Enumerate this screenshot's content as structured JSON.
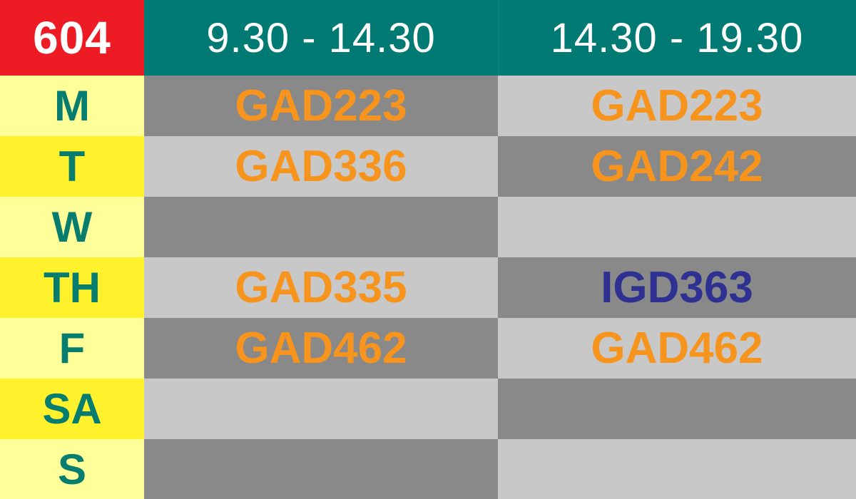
{
  "header": {
    "room": "604",
    "times": [
      "9.30  -  14.30",
      "14.30  -  19.30"
    ]
  },
  "rows": [
    {
      "day": "M",
      "slots": [
        "GAD223",
        "GAD223"
      ]
    },
    {
      "day": "T",
      "slots": [
        "GAD336",
        "GAD242"
      ]
    },
    {
      "day": "W",
      "slots": [
        "",
        ""
      ]
    },
    {
      "day": "TH",
      "slots": [
        "GAD335",
        "IGD363"
      ]
    },
    {
      "day": "F",
      "slots": [
        "GAD462",
        "GAD462"
      ]
    },
    {
      "day": "SA",
      "slots": [
        "",
        ""
      ]
    },
    {
      "day": "S",
      "slots": [
        "",
        ""
      ]
    }
  ],
  "colors": {
    "room_bg": "#ed1c24",
    "header_bg": "#007a73",
    "day_text": "#077d6f",
    "day_bg_light": "#ffff99",
    "day_bg_bright": "#fff22d",
    "slot_dark": "#898989",
    "slot_light": "#c8c8c8",
    "course_orange": "#f7941d",
    "course_navy": "#2e3192"
  }
}
